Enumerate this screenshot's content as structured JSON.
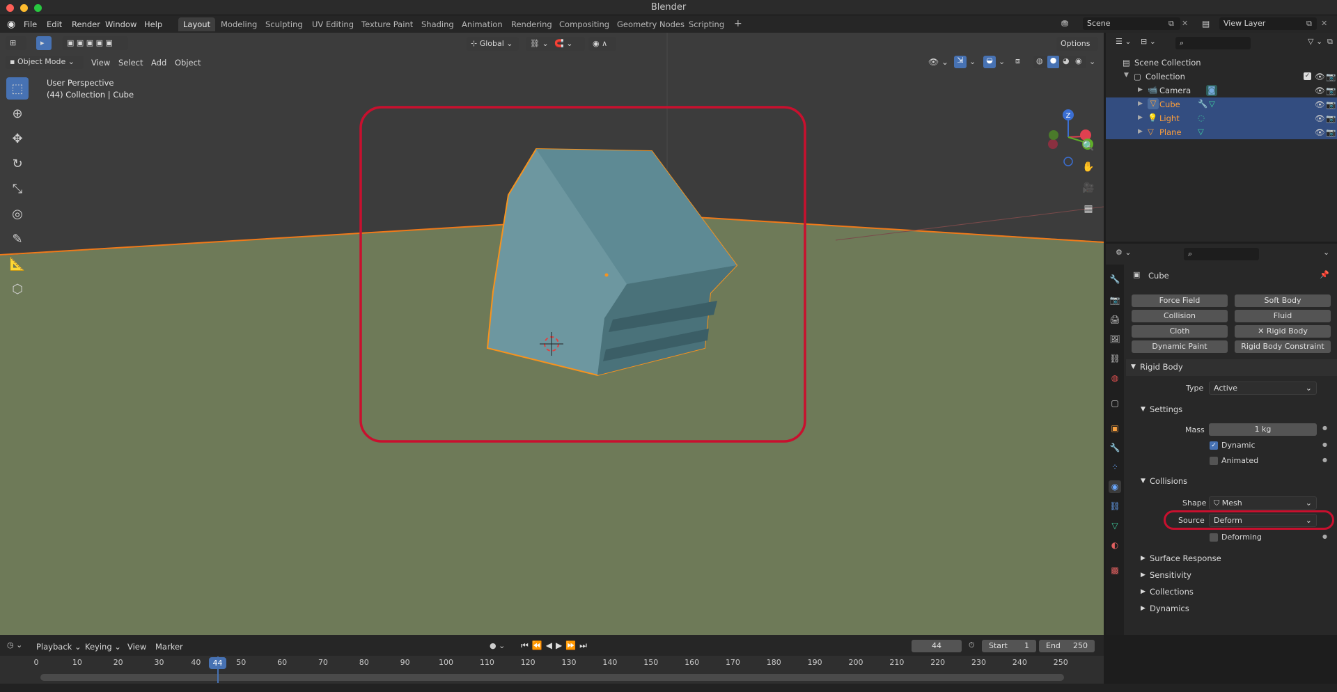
{
  "app": {
    "title": "Blender"
  },
  "menu": {
    "file": "File",
    "edit": "Edit",
    "render": "Render",
    "window": "Window",
    "help": "Help"
  },
  "workspaces": [
    "Layout",
    "Modeling",
    "Sculpting",
    "UV Editing",
    "Texture Paint",
    "Shading",
    "Animation",
    "Rendering",
    "Compositing",
    "Geometry Nodes",
    "Scripting"
  ],
  "scene": {
    "name": "Scene",
    "view_layer": "View Layer"
  },
  "viewport_header": {
    "transform_orientation": "Global",
    "options": "Options",
    "mode": "Object Mode",
    "view": "View",
    "select": "Select",
    "add": "Add",
    "object": "Object"
  },
  "viewport": {
    "perspective": "User Perspective",
    "context": "(44) Collection | Cube"
  },
  "gizmo": {
    "z": "Z"
  },
  "outliner": {
    "root": "Scene Collection",
    "collection": "Collection",
    "items": [
      {
        "name": "Camera",
        "selected": false,
        "color": "#d8d8d8"
      },
      {
        "name": "Cube",
        "selected": true,
        "color": "#ff9f3a"
      },
      {
        "name": "Light",
        "selected": true,
        "color": "#ff9f3a"
      },
      {
        "name": "Plane",
        "selected": true,
        "color": "#ff9f3a"
      }
    ]
  },
  "properties": {
    "object_name": "Cube",
    "physics_buttons": [
      "Force Field",
      "Soft Body",
      "Collision",
      "Fluid",
      "Cloth",
      "Rigid Body",
      "Dynamic Paint",
      "Rigid Body Constraint"
    ],
    "rigid_body": {
      "header": "Rigid Body",
      "type_label": "Type",
      "type_value": "Active",
      "settings_header": "Settings",
      "mass_label": "Mass",
      "mass_value": "1 kg",
      "dynamic_label": "Dynamic",
      "dynamic_checked": true,
      "animated_label": "Animated",
      "animated_checked": false,
      "collisions_header": "Collisions",
      "shape_label": "Shape",
      "shape_value": "Mesh",
      "source_label": "Source",
      "source_value": "Deform",
      "deforming_label": "Deforming",
      "deforming_checked": false,
      "surface_response": "Surface Response",
      "sensitivity": "Sensitivity",
      "collections": "Collections",
      "dynamics": "Dynamics"
    }
  },
  "timeline": {
    "playback": "Playback",
    "keying": "Keying",
    "view": "View",
    "marker": "Marker",
    "current_frame": "44",
    "start_label": "Start",
    "start_value": "1",
    "end_label": "End",
    "end_value": "250",
    "ticks": [
      "0",
      "10",
      "20",
      "30",
      "40",
      "50",
      "60",
      "70",
      "80",
      "90",
      "100",
      "110",
      "120",
      "130",
      "140",
      "150",
      "160",
      "170",
      "180",
      "190",
      "200",
      "210",
      "220",
      "230",
      "240",
      "250"
    ]
  },
  "colors": {
    "accent": "#4772b3",
    "highlight": "#c8102e",
    "selection": "#ff9f3a"
  }
}
